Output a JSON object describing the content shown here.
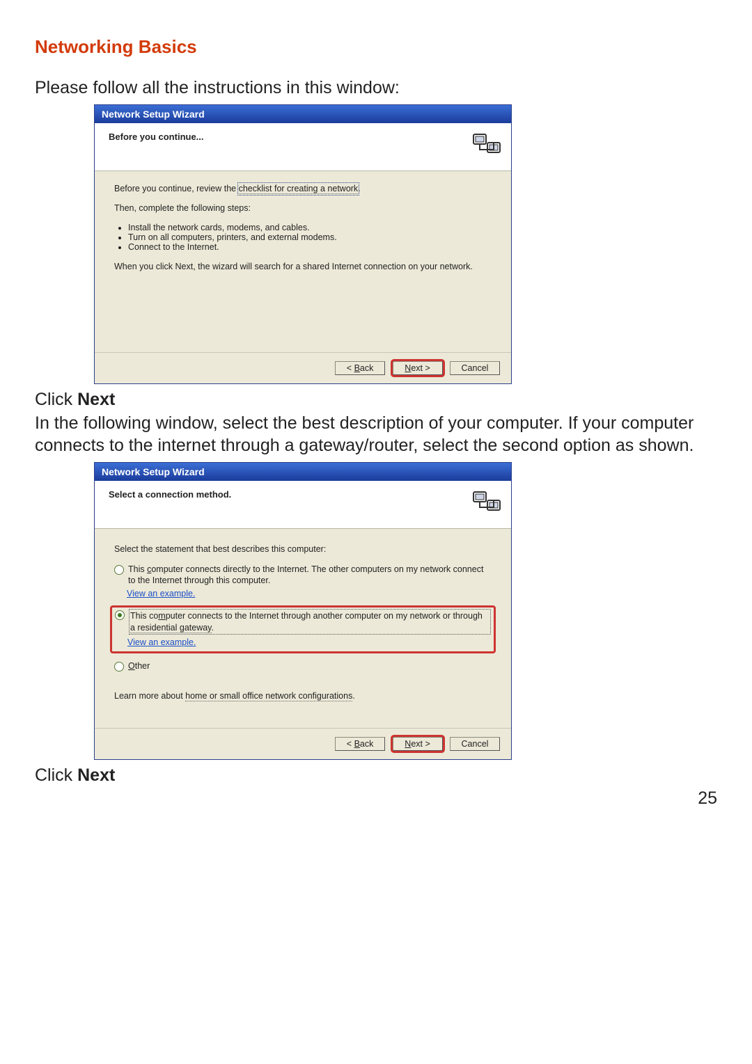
{
  "page": {
    "section_title": "Networking Basics",
    "intro": "Please follow all the instructions in this window:",
    "click_next_prefix": "Click ",
    "click_next_bold": "Next",
    "middle_para": "In the following window, select the best description of your computer.  If your computer connects to the internet through a gateway/router, select the second option as shown.",
    "page_number": "25"
  },
  "dialog1": {
    "title": "Network Setup Wizard",
    "header": "Before you continue...",
    "line1_prefix": "Before you continue, review the ",
    "line1_link": "checklist for creating a network",
    "line1_suffix": ".",
    "line2": "Then, complete the following steps:",
    "bullets": [
      "Install the network cards, modems, and cables.",
      "Turn on all computers, printers, and external modems.",
      "Connect to the Internet."
    ],
    "line3": "When you click Next, the wizard will search for a shared Internet connection on your network.",
    "buttons": {
      "back": "< Back",
      "next": "Next >",
      "cancel": "Cancel"
    }
  },
  "dialog2": {
    "title": "Network Setup Wizard",
    "header": "Select a connection method.",
    "prompt": "Select the statement that best describes this computer:",
    "opt1": "This computer connects directly to the Internet. The other computers on my network connect to the Internet through this computer.",
    "opt2_a": "This computer connects to the Internet through another computer on my network or through ",
    "opt2_b": "a residential gateway",
    "opt2_c": ".",
    "opt3": "Other",
    "view_example": "View an example.",
    "learn_prefix": "Learn more about ",
    "learn_link": "home or small office network configurations",
    "learn_suffix": ".",
    "buttons": {
      "back": "< Back",
      "next": "Next >",
      "cancel": "Cancel"
    }
  }
}
